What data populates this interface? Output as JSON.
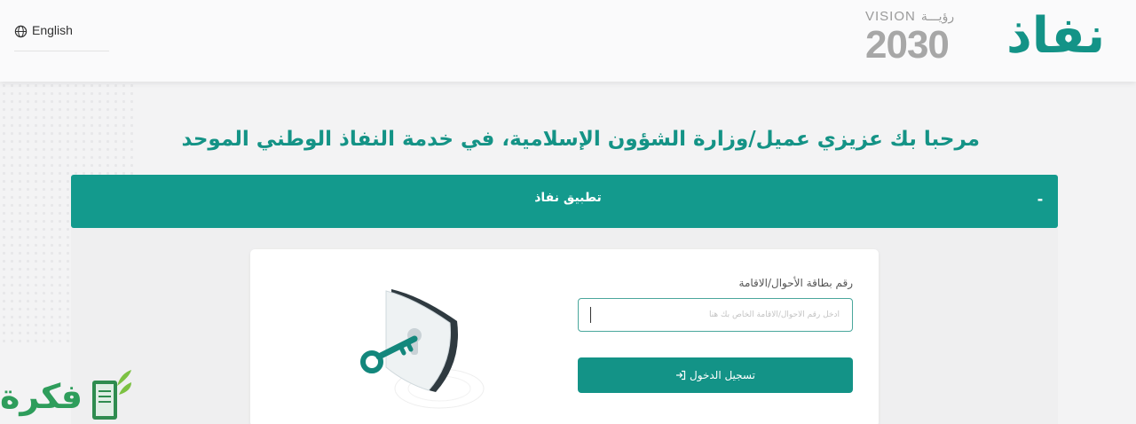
{
  "header": {
    "language_label": "English",
    "vision_latin": "VISION",
    "vision_arabic": "رؤيـــة",
    "vision_year": "2030",
    "logo_text": "نفاذ"
  },
  "welcome_text": "مرحبا بك عزيزي عميل/وزارة الشؤون الإسلامية، في خدمة النفاذ الوطني الموحد",
  "app_section": {
    "title": "تطبيق نفاذ",
    "toggle_symbol": "-"
  },
  "login_form": {
    "field_label": "رقم بطاقة الأحوال/الاقامة",
    "field_placeholder": "أدخل رقم الأحوال/الاقامة الخاص بك هنا",
    "field_value": "",
    "submit_label": "تسجيل الدخول"
  },
  "watermark": {
    "text": "فكرة"
  },
  "colors": {
    "brand_teal": "#139387",
    "bar_teal": "#139a8d",
    "watermark_green": "#2e9d5b"
  }
}
